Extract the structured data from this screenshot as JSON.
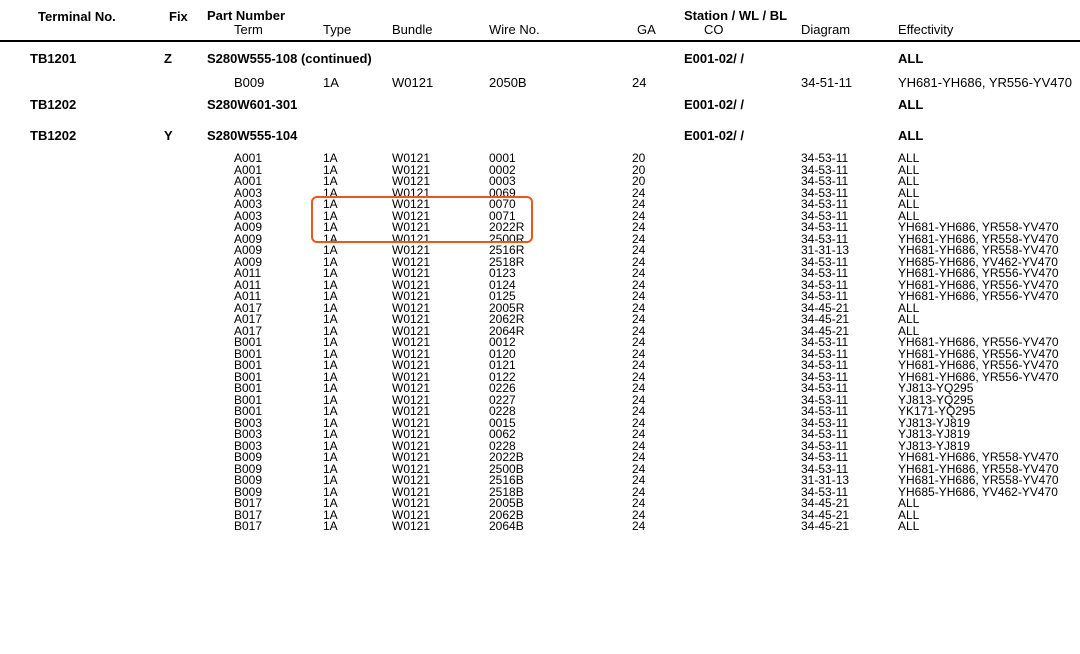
{
  "header": {
    "terminal_no": "Terminal No.",
    "fix": "Fix",
    "part_number": "Part Number",
    "term": "Term",
    "type": "Type",
    "bundle": "Bundle",
    "wire_no": "Wire No.",
    "ga": "GA",
    "station": "Station / WL / BL",
    "co": "CO",
    "diagram": "Diagram",
    "effectivity": "Effectivity"
  },
  "sections": [
    {
      "terminal": "TB1201",
      "fix": "Z",
      "part": "S280W555-108 (continued)",
      "station": "E001-02/ /",
      "effectivity": "ALL"
    },
    {
      "terminal": "TB1202",
      "fix": "",
      "part": "S280W601-301",
      "station": "E001-02/ /",
      "effectivity": "ALL"
    },
    {
      "terminal": "TB1202",
      "fix": "Y",
      "part": "S280W555-104",
      "station": "E001-02/ /",
      "effectivity": "ALL"
    }
  ],
  "sub_row": {
    "term": "B009",
    "type": "1A",
    "bundle": "W0121",
    "wire": "2050B",
    "ga": "24",
    "diagram": "34-51-11",
    "effectivity": "YH681-YH686, YR556-YV470"
  },
  "rows": [
    {
      "term": "A001",
      "type": "1A",
      "bundle": "W0121",
      "wire": "0001",
      "ga": "20",
      "diagram": "34-53-11",
      "effectivity": "ALL"
    },
    {
      "term": "A001",
      "type": "1A",
      "bundle": "W0121",
      "wire": "0002",
      "ga": "20",
      "diagram": "34-53-11",
      "effectivity": "ALL"
    },
    {
      "term": "A001",
      "type": "1A",
      "bundle": "W0121",
      "wire": "0003",
      "ga": "20",
      "diagram": "34-53-11",
      "effectivity": "ALL"
    },
    {
      "term": "A003",
      "type": "1A",
      "bundle": "W0121",
      "wire": "0069",
      "ga": "24",
      "diagram": "34-53-11",
      "effectivity": "ALL"
    },
    {
      "term": "A003",
      "type": "1A",
      "bundle": "W0121",
      "wire": "0070",
      "ga": "24",
      "diagram": "34-53-11",
      "effectivity": "ALL"
    },
    {
      "term": "A003",
      "type": "1A",
      "bundle": "W0121",
      "wire": "0071",
      "ga": "24",
      "diagram": "34-53-11",
      "effectivity": "ALL"
    },
    {
      "term": "A009",
      "type": "1A",
      "bundle": "W0121",
      "wire": "2022R",
      "ga": "24",
      "diagram": "34-53-11",
      "effectivity": "YH681-YH686, YR558-YV470"
    },
    {
      "term": "A009",
      "type": "1A",
      "bundle": "W0121",
      "wire": "2500R",
      "ga": "24",
      "diagram": "34-53-11",
      "effectivity": "YH681-YH686, YR558-YV470"
    },
    {
      "term": "A009",
      "type": "1A",
      "bundle": "W0121",
      "wire": "2516R",
      "ga": "24",
      "diagram": "31-31-13",
      "effectivity": "YH681-YH686, YR558-YV470"
    },
    {
      "term": "A009",
      "type": "1A",
      "bundle": "W0121",
      "wire": "2518R",
      "ga": "24",
      "diagram": "34-53-11",
      "effectivity": "YH685-YH686, YV462-YV470"
    },
    {
      "term": "A011",
      "type": "1A",
      "bundle": "W0121",
      "wire": "0123",
      "ga": "24",
      "diagram": "34-53-11",
      "effectivity": "YH681-YH686, YR556-YV470"
    },
    {
      "term": "A011",
      "type": "1A",
      "bundle": "W0121",
      "wire": "0124",
      "ga": "24",
      "diagram": "34-53-11",
      "effectivity": "YH681-YH686, YR556-YV470"
    },
    {
      "term": "A011",
      "type": "1A",
      "bundle": "W0121",
      "wire": "0125",
      "ga": "24",
      "diagram": "34-53-11",
      "effectivity": "YH681-YH686, YR556-YV470"
    },
    {
      "term": "A017",
      "type": "1A",
      "bundle": "W0121",
      "wire": "2005R",
      "ga": "24",
      "diagram": "34-45-21",
      "effectivity": "ALL"
    },
    {
      "term": "A017",
      "type": "1A",
      "bundle": "W0121",
      "wire": "2062R",
      "ga": "24",
      "diagram": "34-45-21",
      "effectivity": "ALL"
    },
    {
      "term": "A017",
      "type": "1A",
      "bundle": "W0121",
      "wire": "2064R",
      "ga": "24",
      "diagram": "34-45-21",
      "effectivity": "ALL"
    },
    {
      "term": "B001",
      "type": "1A",
      "bundle": "W0121",
      "wire": "0012",
      "ga": "24",
      "diagram": "34-53-11",
      "effectivity": "YH681-YH686, YR556-YV470"
    },
    {
      "term": "B001",
      "type": "1A",
      "bundle": "W0121",
      "wire": "0120",
      "ga": "24",
      "diagram": "34-53-11",
      "effectivity": "YH681-YH686, YR556-YV470"
    },
    {
      "term": "B001",
      "type": "1A",
      "bundle": "W0121",
      "wire": "0121",
      "ga": "24",
      "diagram": "34-53-11",
      "effectivity": "YH681-YH686, YR556-YV470"
    },
    {
      "term": "B001",
      "type": "1A",
      "bundle": "W0121",
      "wire": "0122",
      "ga": "24",
      "diagram": "34-53-11",
      "effectivity": "YH681-YH686, YR556-YV470"
    },
    {
      "term": "B001",
      "type": "1A",
      "bundle": "W0121",
      "wire": "0226",
      "ga": "24",
      "diagram": "34-53-11",
      "effectivity": "YJ813-YQ295"
    },
    {
      "term": "B001",
      "type": "1A",
      "bundle": "W0121",
      "wire": "0227",
      "ga": "24",
      "diagram": "34-53-11",
      "effectivity": "YJ813-YQ295"
    },
    {
      "term": "B001",
      "type": "1A",
      "bundle": "W0121",
      "wire": "0228",
      "ga": "24",
      "diagram": "34-53-11",
      "effectivity": "YK171-YQ295"
    },
    {
      "term": "B003",
      "type": "1A",
      "bundle": "W0121",
      "wire": "0015",
      "ga": "24",
      "diagram": "34-53-11",
      "effectivity": "YJ813-YJ819"
    },
    {
      "term": "B003",
      "type": "1A",
      "bundle": "W0121",
      "wire": "0062",
      "ga": "24",
      "diagram": "34-53-11",
      "effectivity": "YJ813-YJ819"
    },
    {
      "term": "B003",
      "type": "1A",
      "bundle": "W0121",
      "wire": "0228",
      "ga": "24",
      "diagram": "34-53-11",
      "effectivity": "YJ813-YJ819"
    },
    {
      "term": "B009",
      "type": "1A",
      "bundle": "W0121",
      "wire": "2022B",
      "ga": "24",
      "diagram": "34-53-11",
      "effectivity": "YH681-YH686, YR558-YV470"
    },
    {
      "term": "B009",
      "type": "1A",
      "bundle": "W0121",
      "wire": "2500B",
      "ga": "24",
      "diagram": "34-53-11",
      "effectivity": "YH681-YH686, YR558-YV470"
    },
    {
      "term": "B009",
      "type": "1A",
      "bundle": "W0121",
      "wire": "2516B",
      "ga": "24",
      "diagram": "31-31-13",
      "effectivity": "YH681-YH686, YR558-YV470"
    },
    {
      "term": "B009",
      "type": "1A",
      "bundle": "W0121",
      "wire": "2518B",
      "ga": "24",
      "diagram": "34-53-11",
      "effectivity": "YH685-YH686, YV462-YV470"
    },
    {
      "term": "B017",
      "type": "1A",
      "bundle": "W0121",
      "wire": "2005B",
      "ga": "24",
      "diagram": "34-45-21",
      "effectivity": "ALL"
    },
    {
      "term": "B017",
      "type": "1A",
      "bundle": "W0121",
      "wire": "2062B",
      "ga": "24",
      "diagram": "34-45-21",
      "effectivity": "ALL"
    },
    {
      "term": "B017",
      "type": "1A",
      "bundle": "W0121",
      "wire": "2064B",
      "ga": "24",
      "diagram": "34-45-21",
      "effectivity": "ALL"
    }
  ],
  "highlight": {
    "color": "#e8581c",
    "rows": [
      "A003 0069",
      "A003 0070",
      "A003 0071"
    ]
  }
}
